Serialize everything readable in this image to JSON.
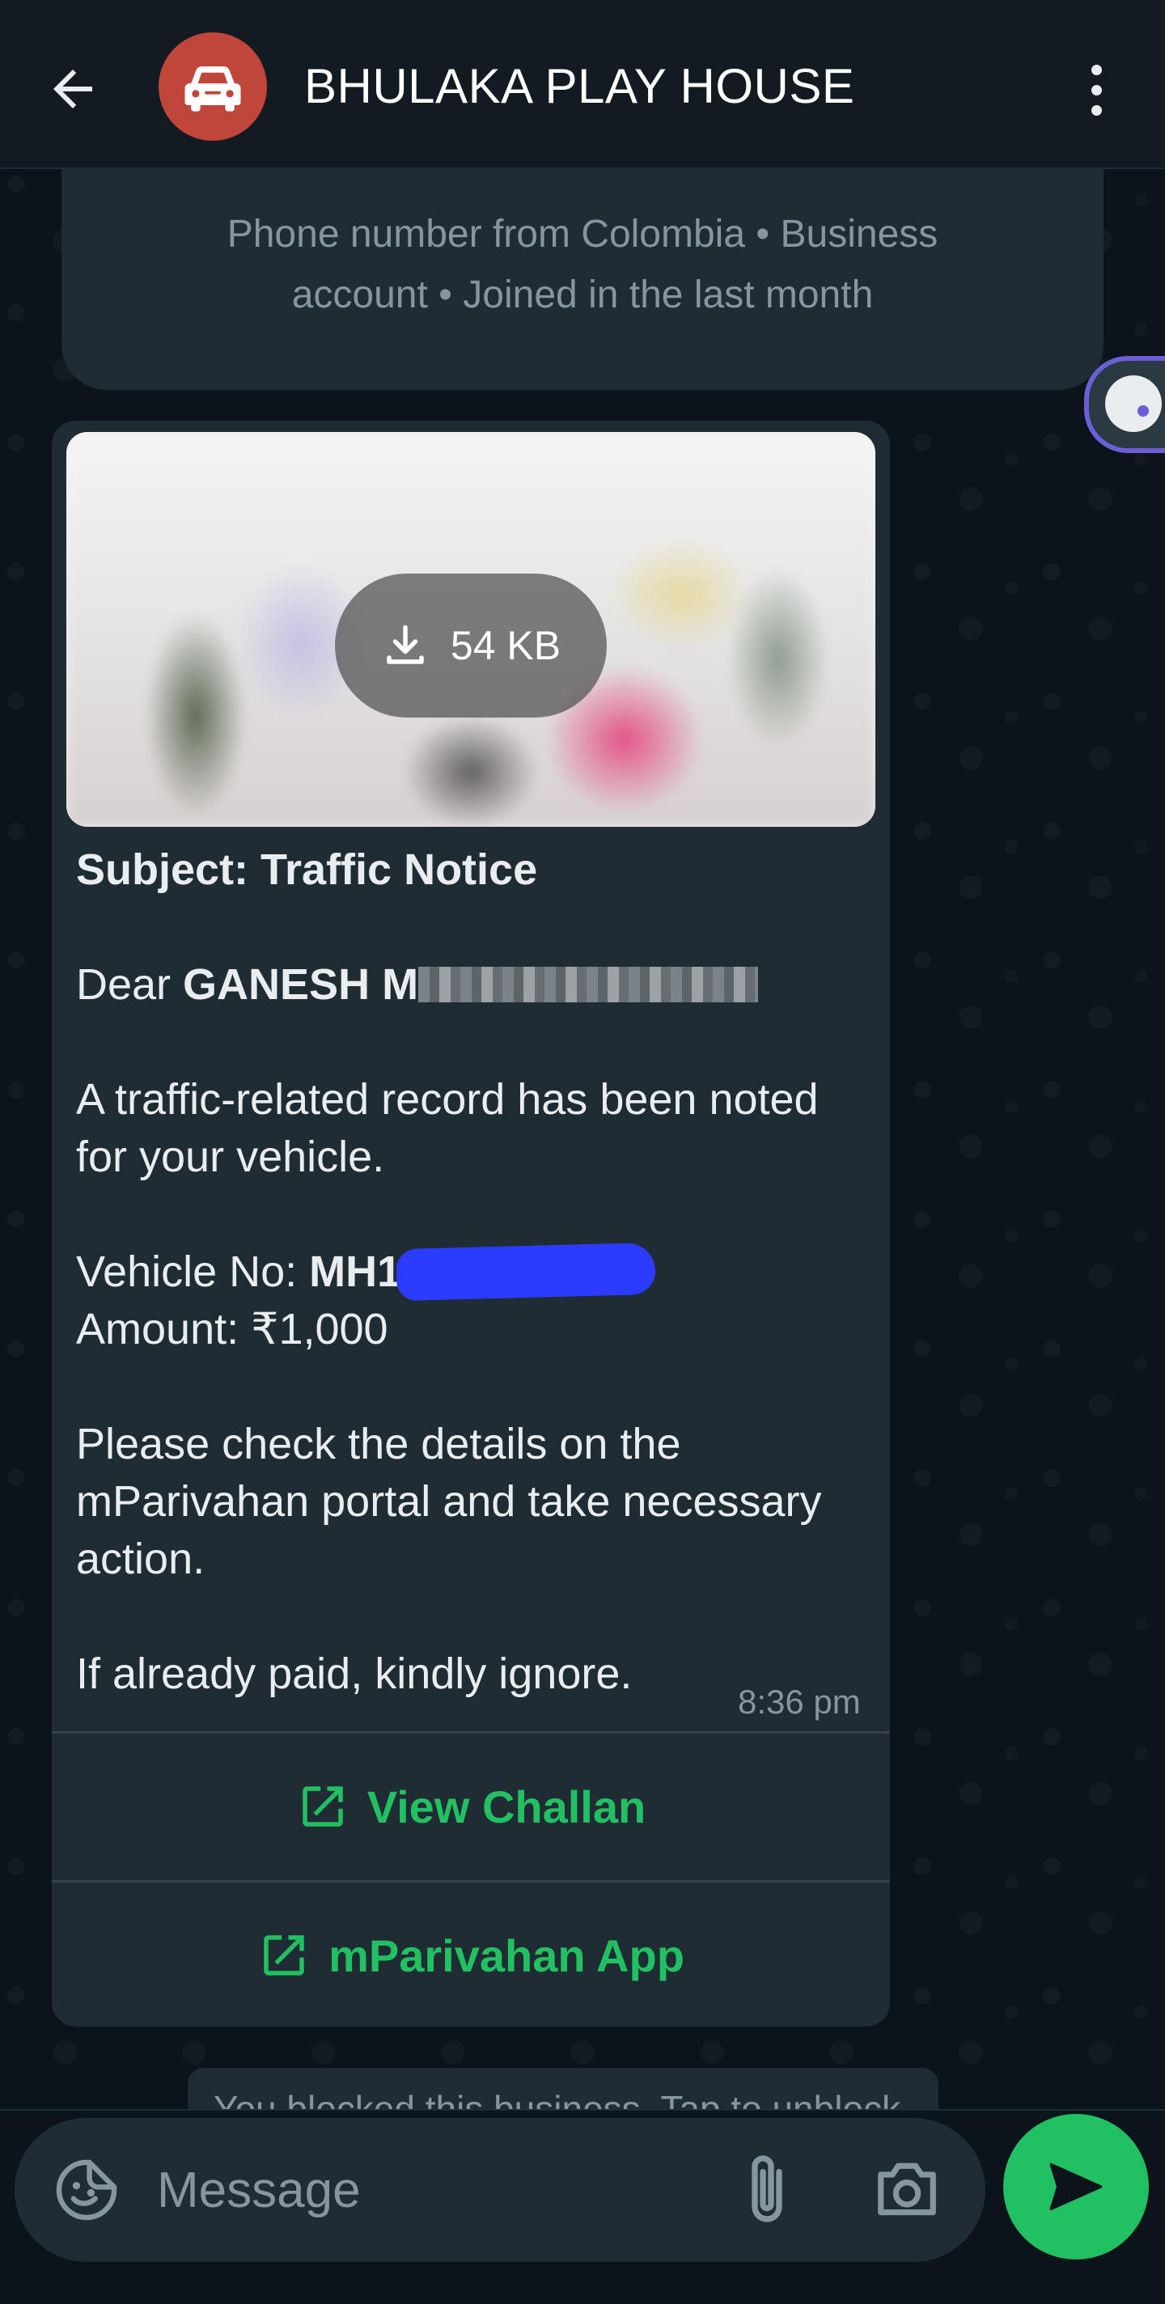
{
  "header": {
    "title": "BHULAKA PLAY HOUSE",
    "back_icon": "arrow-left-icon",
    "avatar_icon": "car-icon",
    "avatar_color": "#c0453a",
    "menu_icon": "more-vertical-icon"
  },
  "info_card": {
    "text": "Phone number from Colombia • Business account • Joined in the last month"
  },
  "message": {
    "media": {
      "size_label": "54 KB",
      "icon": "download-icon"
    },
    "subject": "Subject: Traffic Notice",
    "greeting_prefix": "Dear ",
    "greeting_name": "GANESH M",
    "line1": "A traffic-related record has been noted for your vehicle.",
    "vehicle_label": "Vehicle No: ",
    "vehicle_value": "MH1",
    "amount": "Amount: ₹1,000",
    "line2": "Please check the details on the mParivahan portal and take necessary action.",
    "line3": "If already paid, kindly ignore.",
    "time": "8:36 pm",
    "buttons": [
      {
        "label": "View Challan",
        "icon": "external-link-icon"
      },
      {
        "label": "mParivahan App",
        "icon": "external-link-icon"
      }
    ]
  },
  "blocked_banner": "You blocked this business. Tap to unblock.",
  "composer": {
    "placeholder": "Message",
    "sticker_icon": "sticker-icon",
    "attach_icon": "paperclip-icon",
    "camera_icon": "camera-icon",
    "send_icon": "send-icon"
  },
  "colors": {
    "background": "#0b141a",
    "bubble": "#202c33",
    "accent": "#21c063",
    "muted_text": "#8696a0"
  }
}
